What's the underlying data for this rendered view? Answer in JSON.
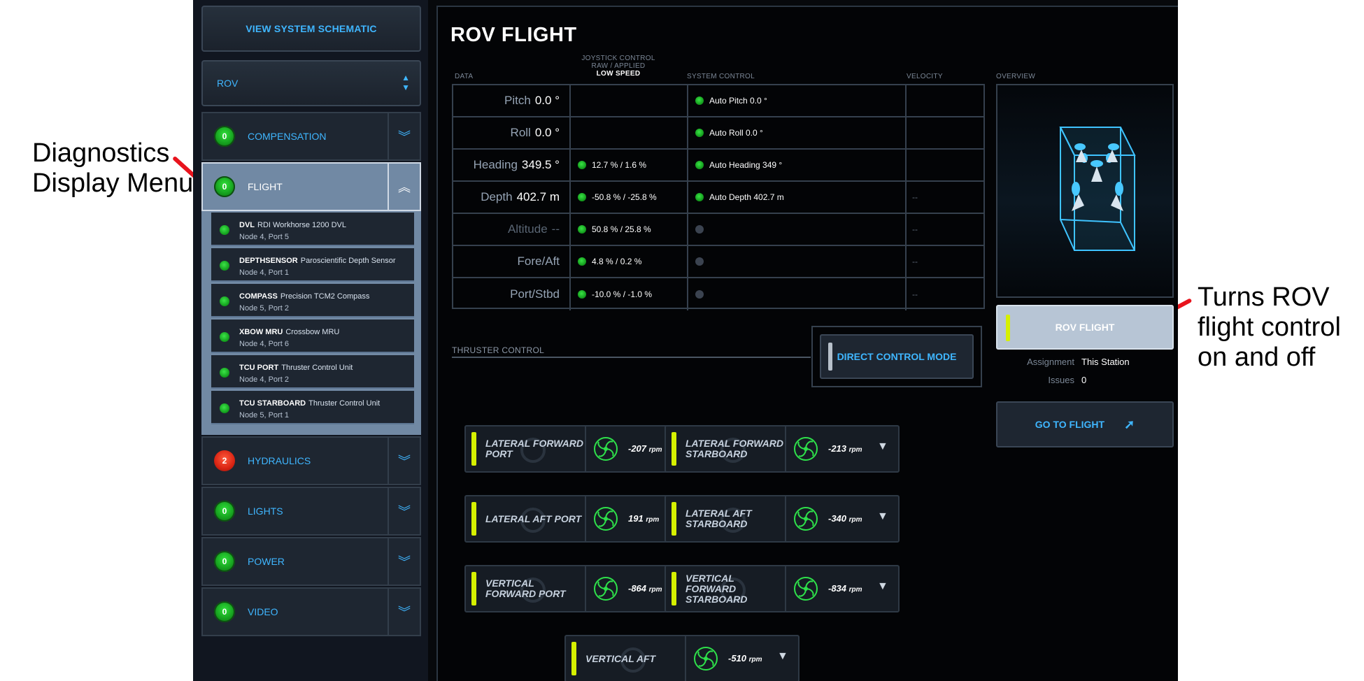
{
  "annotations": {
    "left": "Diagnostics Display Menu",
    "right": "Turns ROV flight control on and off"
  },
  "sidebar": {
    "schematic_button": "VIEW SYSTEM SCHEMATIC",
    "vehicle_select": "ROV",
    "sections": [
      {
        "label": "COMPENSATION",
        "count": "0",
        "status": "ok"
      },
      {
        "label": "FLIGHT",
        "count": "0",
        "status": "ok"
      },
      {
        "label": "HYDRAULICS",
        "count": "2",
        "status": "error"
      },
      {
        "label": "LIGHTS",
        "count": "0",
        "status": "ok"
      },
      {
        "label": "POWER",
        "count": "0",
        "status": "ok"
      },
      {
        "label": "VIDEO",
        "count": "0",
        "status": "ok"
      }
    ],
    "devices": [
      {
        "name": "DVL",
        "desc": "RDI Workhorse 1200 DVL",
        "loc": "Node 4, Port 5"
      },
      {
        "name": "DEPTHSENSOR",
        "desc": "Paroscientific Depth Sensor",
        "loc": "Node 4, Port 1"
      },
      {
        "name": "COMPASS",
        "desc": "Precision TCM2 Compass",
        "loc": "Node 5, Port 2"
      },
      {
        "name": "XBOW MRU",
        "desc": "Crossbow MRU",
        "loc": "Node 4, Port 6"
      },
      {
        "name": "TCU PORT",
        "desc": "Thruster Control Unit",
        "loc": "Node 4, Port 2"
      },
      {
        "name": "TCU STARBOARD",
        "desc": "Thruster Control Unit",
        "loc": "Node 5, Port 1"
      }
    ]
  },
  "main": {
    "title": "ROV FLIGHT",
    "headers": {
      "data": "DATA",
      "joystick_l1": "JOYSTICK CONTROL",
      "joystick_l2": "RAW / APPLIED",
      "joystick_l3": "LOW SPEED",
      "system": "SYSTEM CONTROL",
      "velocity": "VELOCITY",
      "overview": "OVERVIEW"
    },
    "rows": [
      {
        "label": "Pitch",
        "value": "0.0 °",
        "joystick": "",
        "system": "Auto Pitch 0.0 °",
        "system_active": true,
        "velocity": ""
      },
      {
        "label": "Roll",
        "value": "0.0 °",
        "joystick": "",
        "system": "Auto Roll 0.0 °",
        "system_active": true,
        "velocity": ""
      },
      {
        "label": "Heading",
        "value": "349.5 °",
        "joystick": "12.7 % / 1.6 %",
        "system": "Auto Heading 349 °",
        "system_active": true,
        "velocity": ""
      },
      {
        "label": "Depth",
        "value": "402.7 m",
        "joystick": "-50.8 % / -25.8 %",
        "system": "Auto Depth 402.7 m",
        "system_active": true,
        "velocity": "--"
      },
      {
        "label": "Altitude",
        "value": "--",
        "joystick": "50.8 % / 25.8 %",
        "system": "",
        "system_active": false,
        "velocity": "--"
      },
      {
        "label": "Fore/Aft",
        "value": "",
        "joystick": "4.8 % / 0.2 %",
        "system": "",
        "system_active": false,
        "velocity": "--"
      },
      {
        "label": "Port/Stbd",
        "value": "",
        "joystick": "-10.0 % / -1.0 %",
        "system": "",
        "system_active": false,
        "velocity": "--"
      }
    ],
    "rov_flight_button": "ROV FLIGHT",
    "assignment_label": "Assignment",
    "assignment_value": "This Station",
    "issues_label": "Issues",
    "issues_value": "0",
    "go_to_flight": "GO TO FLIGHT",
    "thruster_control": "THRUSTER CONTROL",
    "direct_control_mode": "DIRECT CONTROL MODE",
    "rpm_unit": "rpm",
    "thrusters": [
      {
        "name": "LATERAL FORWARD PORT",
        "rpm": "-207"
      },
      {
        "name": "LATERAL FORWARD STARBOARD",
        "rpm": "-213"
      },
      {
        "name": "LATERAL AFT PORT",
        "rpm": "191"
      },
      {
        "name": "LATERAL AFT STARBOARD",
        "rpm": "-340"
      },
      {
        "name": "VERTICAL FORWARD PORT",
        "rpm": "-864"
      },
      {
        "name": "VERTICAL FORWARD STARBOARD",
        "rpm": "-834"
      },
      {
        "name": "VERTICAL AFT",
        "rpm": "-510"
      }
    ]
  },
  "colors": {
    "accent": "#3fb6ff",
    "status_ok": "#149a1c",
    "status_error": "#d92413",
    "led_on": "#d6f000",
    "annotation": "#e8141d"
  }
}
